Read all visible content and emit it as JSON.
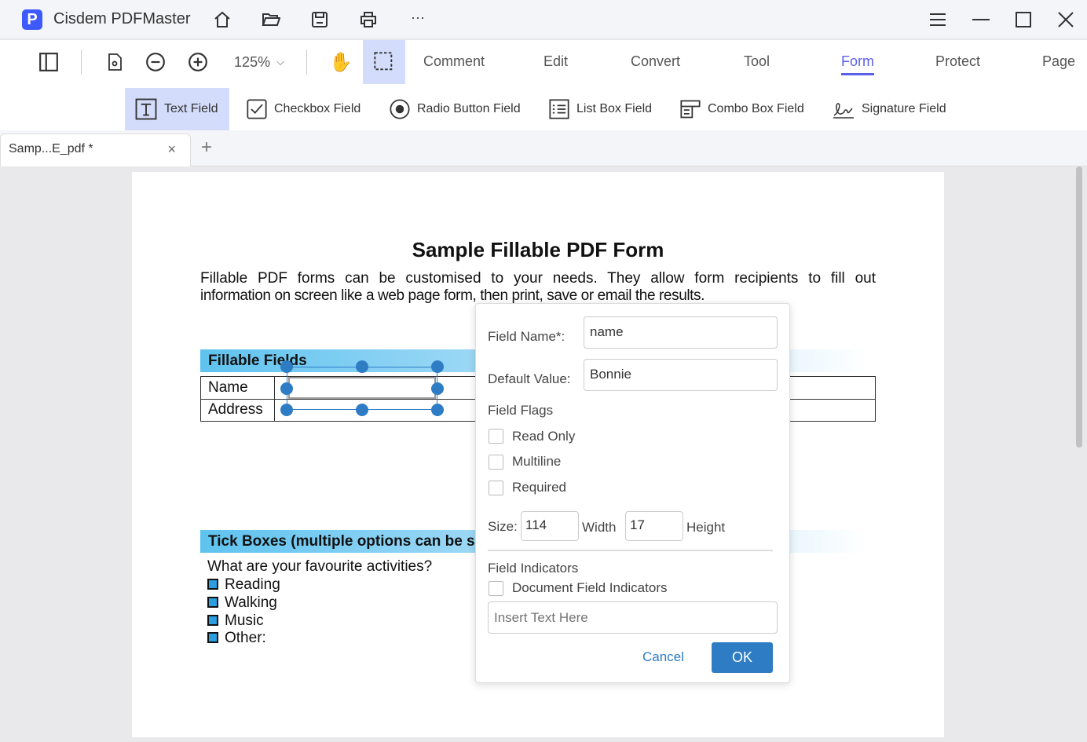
{
  "app": {
    "title": "Cisdem PDFMaster",
    "logo_letter": "P"
  },
  "toolbar": {
    "zoom": "125%",
    "menus": [
      "Comment",
      "Edit",
      "Convert",
      "Tool",
      "Form",
      "Protect",
      "Page"
    ],
    "active_menu": "Form"
  },
  "formbar": [
    "Text Field",
    "Checkbox Field",
    "Radio Button Field",
    "List Box Field",
    "Combo Box Field",
    "Signature Field"
  ],
  "tab": {
    "name": "Samp...E_pdf *",
    "close": "×",
    "add": "+"
  },
  "doc": {
    "title": "Sample Fillable PDF Form",
    "intro1": "Fillable PDF forms can be customised to your needs. They allow form recipients to fill out",
    "intro2": "information on screen like a web page form, then print, save or email the results.",
    "section1": "Fillable Fields",
    "rows": [
      "Name",
      "Address"
    ],
    "section2": "Tick Boxes (multiple options can be selected)",
    "question": "What are your favourite activities?",
    "options": [
      "Reading",
      "Walking",
      "Music",
      "Other:"
    ]
  },
  "dialog": {
    "field_name_label": "Field Name*:",
    "field_name": "name",
    "default_label": "Default Value:",
    "default_value": "Bonnie",
    "flags_label": "Field Flags",
    "flags": [
      "Read Only",
      "Multiline",
      "Required"
    ],
    "size_label": "Size:",
    "width": "114",
    "width_label": "Width",
    "height": "17",
    "height_label": "Height",
    "indicators_label": "Field Indicators",
    "indicator": "Document Field Indicators",
    "placeholder": "Insert Text Here",
    "cancel": "Cancel",
    "ok": "OK"
  },
  "colors": {
    "accent": "#5b5fe8",
    "ok": "#2e7cc4",
    "highlight": "#d3dcfa"
  }
}
